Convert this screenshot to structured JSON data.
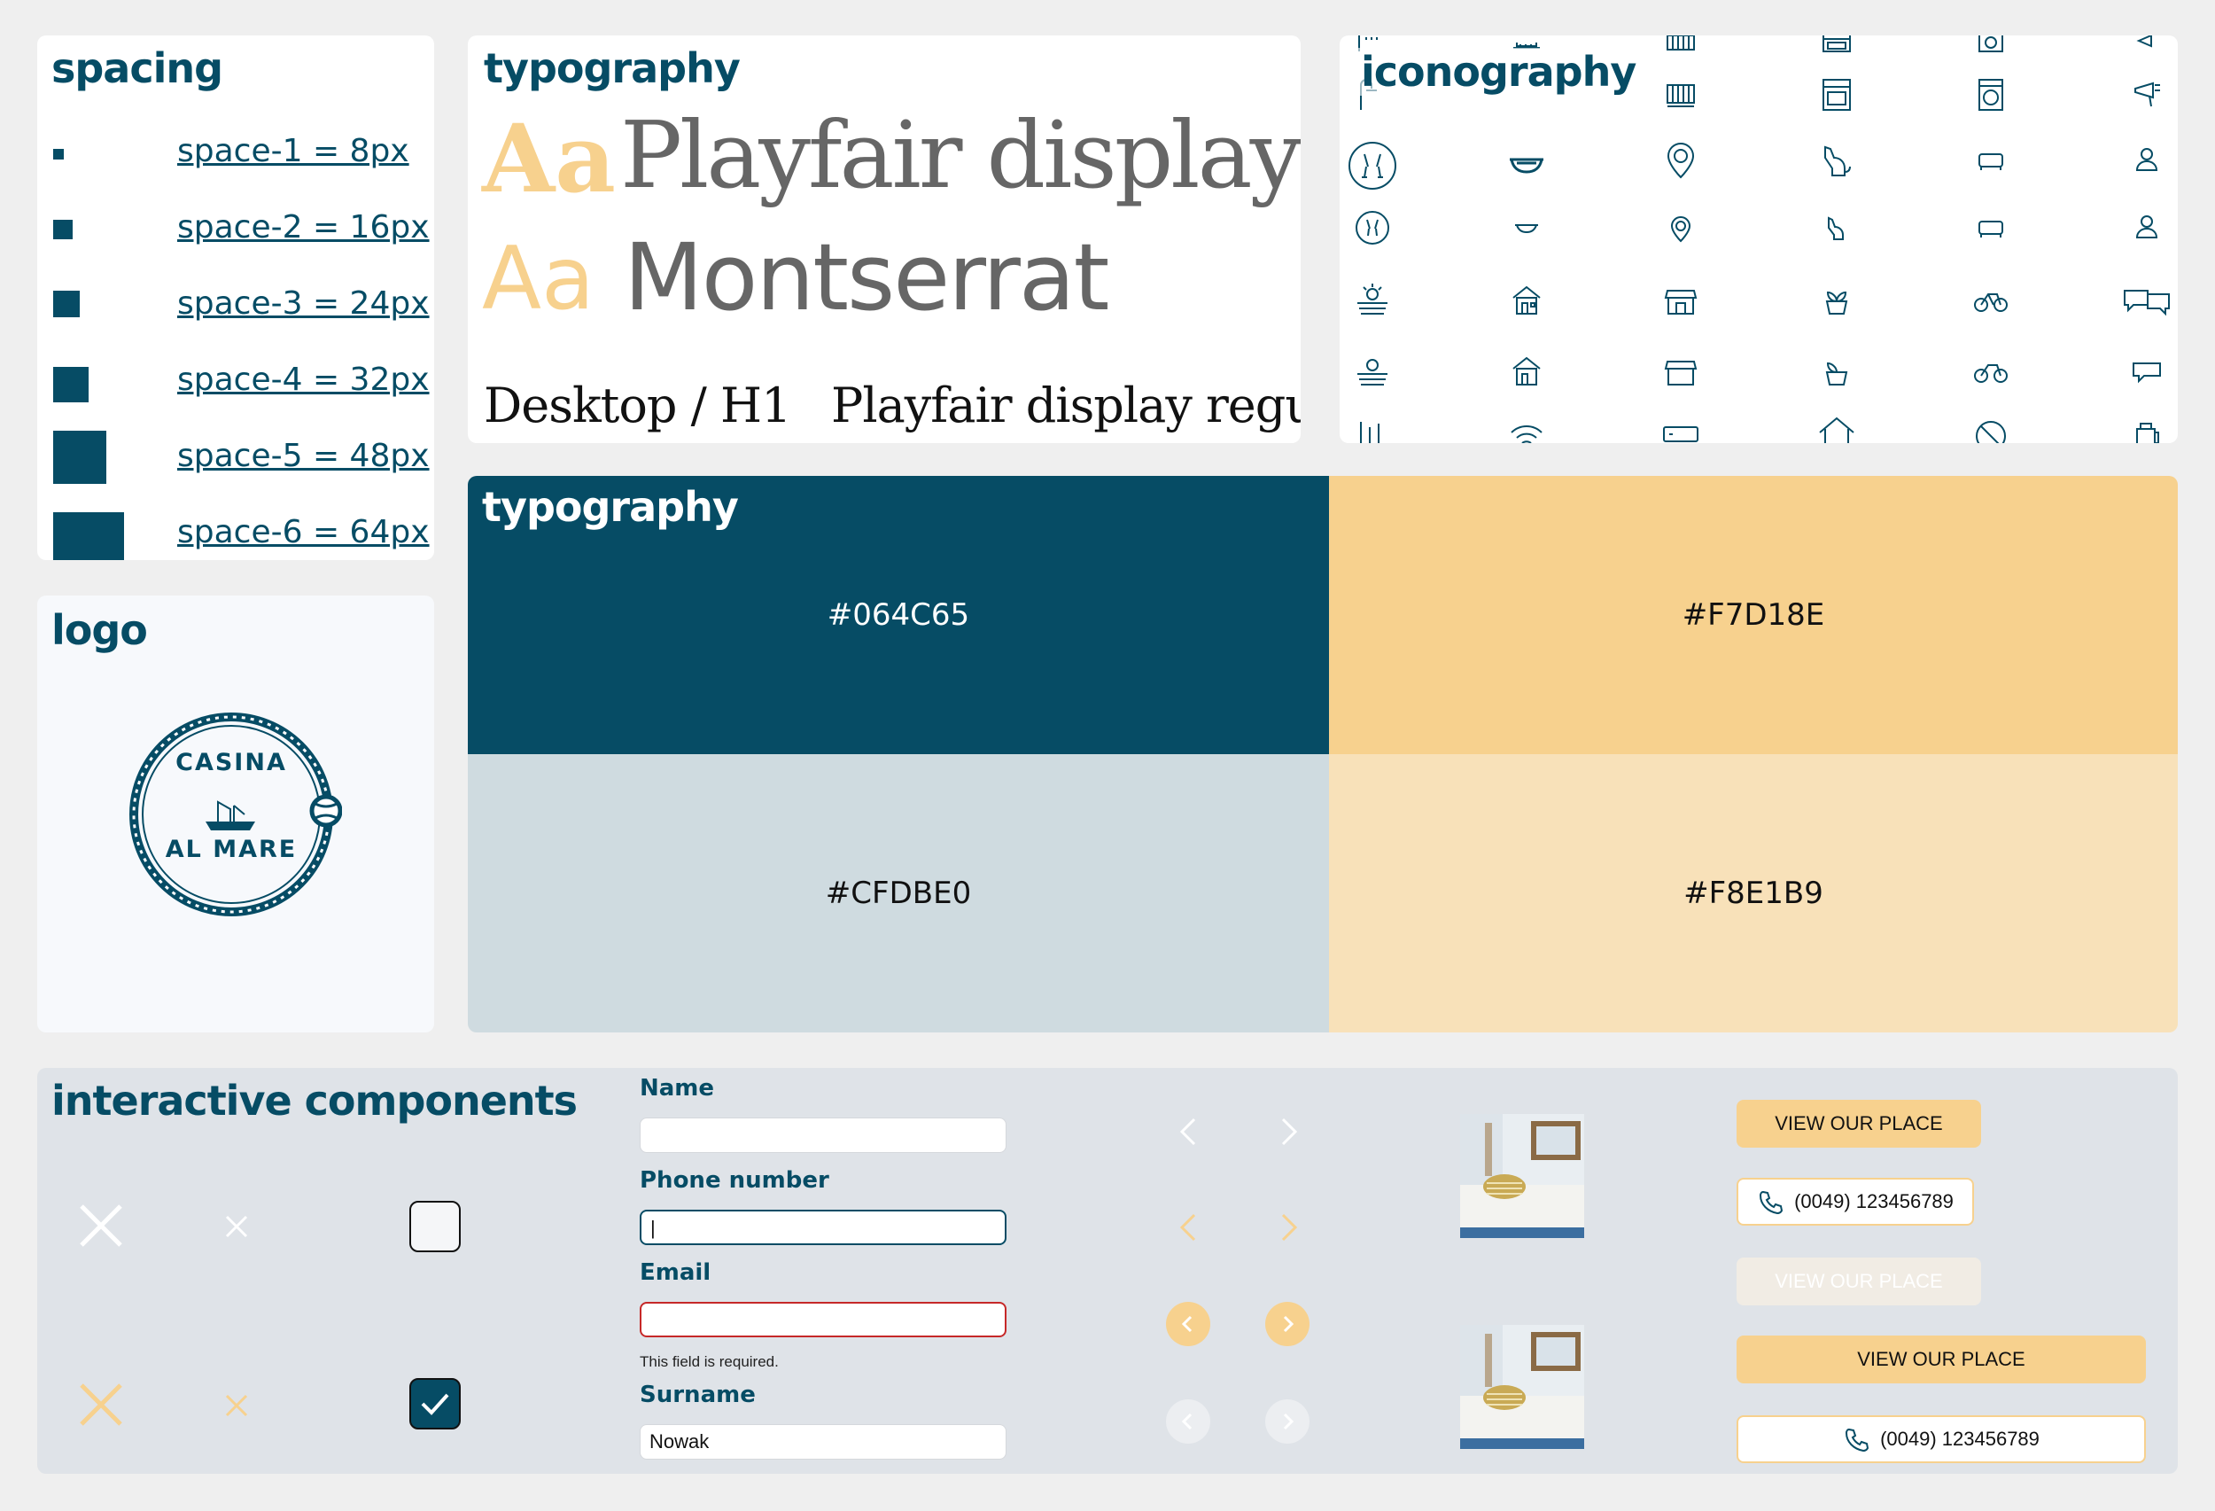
{
  "spacing": {
    "title": "spacing",
    "items": [
      {
        "label": "space-1 = 8px"
      },
      {
        "label": "space-2 = 16px"
      },
      {
        "label": "space-3 = 24px"
      },
      {
        "label": "space-4 = 32px"
      },
      {
        "label": "space-5 = 48px"
      },
      {
        "label": "space-6 = 64px"
      }
    ]
  },
  "typography": {
    "title": "typography",
    "aa": "Aa",
    "font1": "Playfair display",
    "font2": "Montserrat",
    "h1_label": "Desktop / H1",
    "h1_font": "Playfair display regular"
  },
  "iconography": {
    "title": "iconography",
    "icons": [
      "shower-icon",
      "crib-icon",
      "oven-icon",
      "washing-machine-icon",
      "hairdryer-icon",
      "champagne-icon",
      "bathtub-icon",
      "location-pin-icon",
      "dog-icon",
      "sofa-icon",
      "user-icon",
      "beach-icon",
      "beach-house-icon",
      "shop-icon",
      "plant-pot-icon",
      "bicycle-icon",
      "chat-icon",
      "wifi-icon",
      "air-conditioner-icon",
      "house-icon",
      "no-smoking-icon",
      "kettle-icon"
    ]
  },
  "colors": {
    "title": "typography",
    "swatches": [
      {
        "hex": "#064C65",
        "color": "#064c65",
        "text": "#ffffff"
      },
      {
        "hex": "#F7D18E",
        "color": "#f7d18e",
        "text": "#111111"
      },
      {
        "hex": "#CFDBE0",
        "color": "#cfdbe0",
        "text": "#111111"
      },
      {
        "hex": "#F8E1B9",
        "color": "#f8e1b9",
        "text": "#111111"
      }
    ]
  },
  "logo": {
    "title": "logo",
    "line1": "CASINA",
    "line2": "AL MARE"
  },
  "interactive": {
    "title": "interactive components",
    "name_label": "Name",
    "name_value": "",
    "phone_label": "Phone number",
    "phone_value": "|",
    "email_label": "Email",
    "email_value": "",
    "email_error": "This field is required.",
    "surname_label": "Surname",
    "surname_value": "Nowak",
    "view_place": "VIEW OUR PLACE",
    "phone_button": "(0049) 123456789"
  },
  "palette": {
    "primary": "#064c65",
    "accent": "#f7d18e",
    "light_blue": "#cfdbe0",
    "light_yellow": "#f8e1b9",
    "error": "#c62828"
  }
}
